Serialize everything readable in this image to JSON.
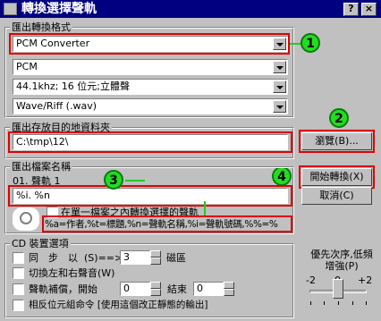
{
  "window": {
    "title": "轉換選擇聲軌",
    "help_btn": "?",
    "close_btn": "×"
  },
  "output_format": {
    "legend": "匯出轉換格式",
    "converter": "PCM Converter",
    "codec": "PCM",
    "quality": "44.1khz; 16 位元;立體聲",
    "container": "Wave/Riff (.wav)"
  },
  "output_folder": {
    "legend": "匯出存放目的地資料夾",
    "path": "C:\\tmp\\12\\",
    "browse_label": "瀏覽(B)..."
  },
  "file_name": {
    "legend": "匯出檔案名稱",
    "track_label": "01. 聲軌 1",
    "pattern": "%i. %n",
    "single_file_label": "在單一檔案之內轉換選擇的聲軌",
    "help_text": "%a=作者,%t=標題,%n=聲軌名稱,%i=聲軌號碼,%%=%"
  },
  "actions": {
    "start_label": "開始轉換(X)",
    "cancel_label": "取消(C)"
  },
  "cd_options": {
    "legend": "CD 裝置選項",
    "sync_label_a": "同　步　以",
    "sync_label_b": "(S)==>",
    "sync_value": "3",
    "sync_unit": "磁區",
    "swap_label": "切換左和右聲音(W)",
    "gap_label": "聲軌補償，開始",
    "gap_start": "0",
    "gap_end_label": "結束",
    "gap_end": "0",
    "phase_label": "相反位元組命令 [使用這個改正靜態的輸出]"
  },
  "priority": {
    "label": "優先次序,低頻增強(P)",
    "scale_min": "-2",
    "scale_mid": "0",
    "scale_max": "+2"
  },
  "annotations": {
    "1": "1",
    "2": "2",
    "3": "3",
    "4": "4"
  },
  "colors": {
    "annotation_box": "#e00000",
    "annotation_circle": "#22dd22",
    "titlebar": "#000080",
    "window_bg": "#c0c0c0"
  }
}
